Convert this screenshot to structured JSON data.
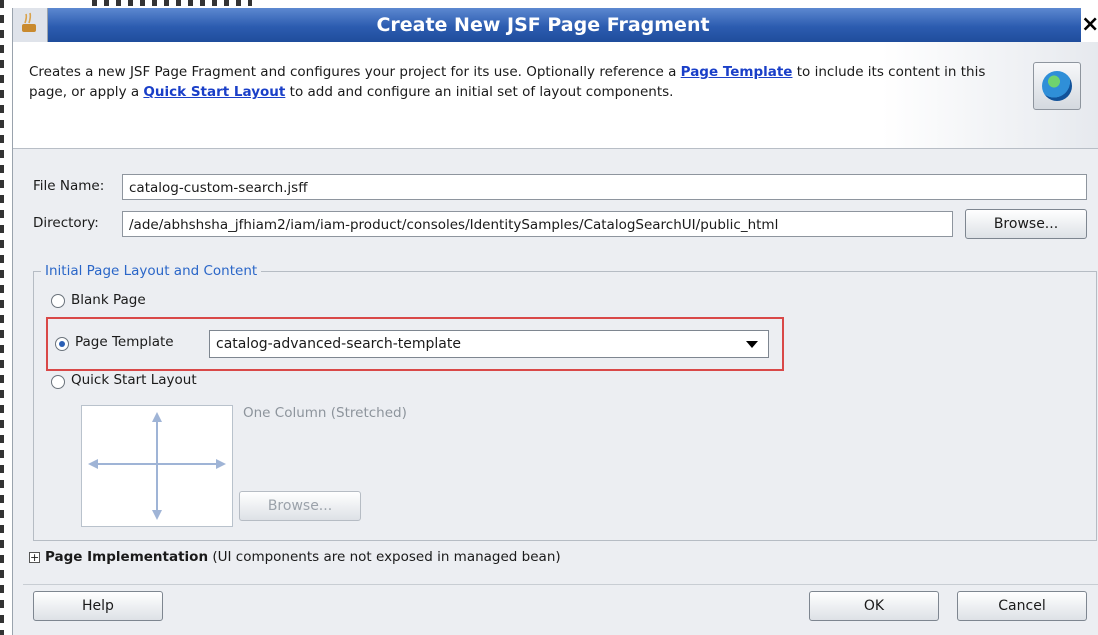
{
  "dialog": {
    "title": "Create New JSF Page Fragment",
    "close_glyph": "×",
    "description_before_link1": "Creates a new JSF Page Fragment and configures your project for its use. Optionally reference a ",
    "link1": "Page Template",
    "description_between": " to include its content in this page, or apply a ",
    "link2": "Quick Start Layout",
    "description_after_link2": " to add and configure an initial set of layout components."
  },
  "form": {
    "file_name_label": "File Name:",
    "file_name_value": "catalog-custom-search.jsff",
    "directory_label": "Directory:",
    "directory_value": "/ade/abhshsha_jfhiam2/iam/iam-product/consoles/IdentitySamples/CatalogSearchUI/public_html",
    "browse_label": "Browse..."
  },
  "layout_group": {
    "title": "Initial Page Layout and Content",
    "blank_page_label": "Blank Page",
    "page_template_label": "Page Template",
    "page_template_value": "catalog-advanced-search-template",
    "quick_start_label": "Quick Start Layout",
    "layout_caption": "One Column (Stretched)",
    "layout_browse_label": "Browse..."
  },
  "implementation": {
    "expander_glyph": "+",
    "label_bold": "Page Implementation",
    "label_rest": " (UI components are not exposed in managed bean)"
  },
  "footer": {
    "help_label": "Help",
    "ok_label": "OK",
    "cancel_label": "Cancel"
  },
  "colors": {
    "titlebar": "#2c5cb0",
    "link": "#1a3fc8",
    "group_title": "#2a66c8",
    "highlight_border": "#d94848"
  },
  "icons": [
    "app-icon",
    "close-icon",
    "globe-icon",
    "dropdown-arrow-icon",
    "layout-preview-icon",
    "expand-icon"
  ]
}
